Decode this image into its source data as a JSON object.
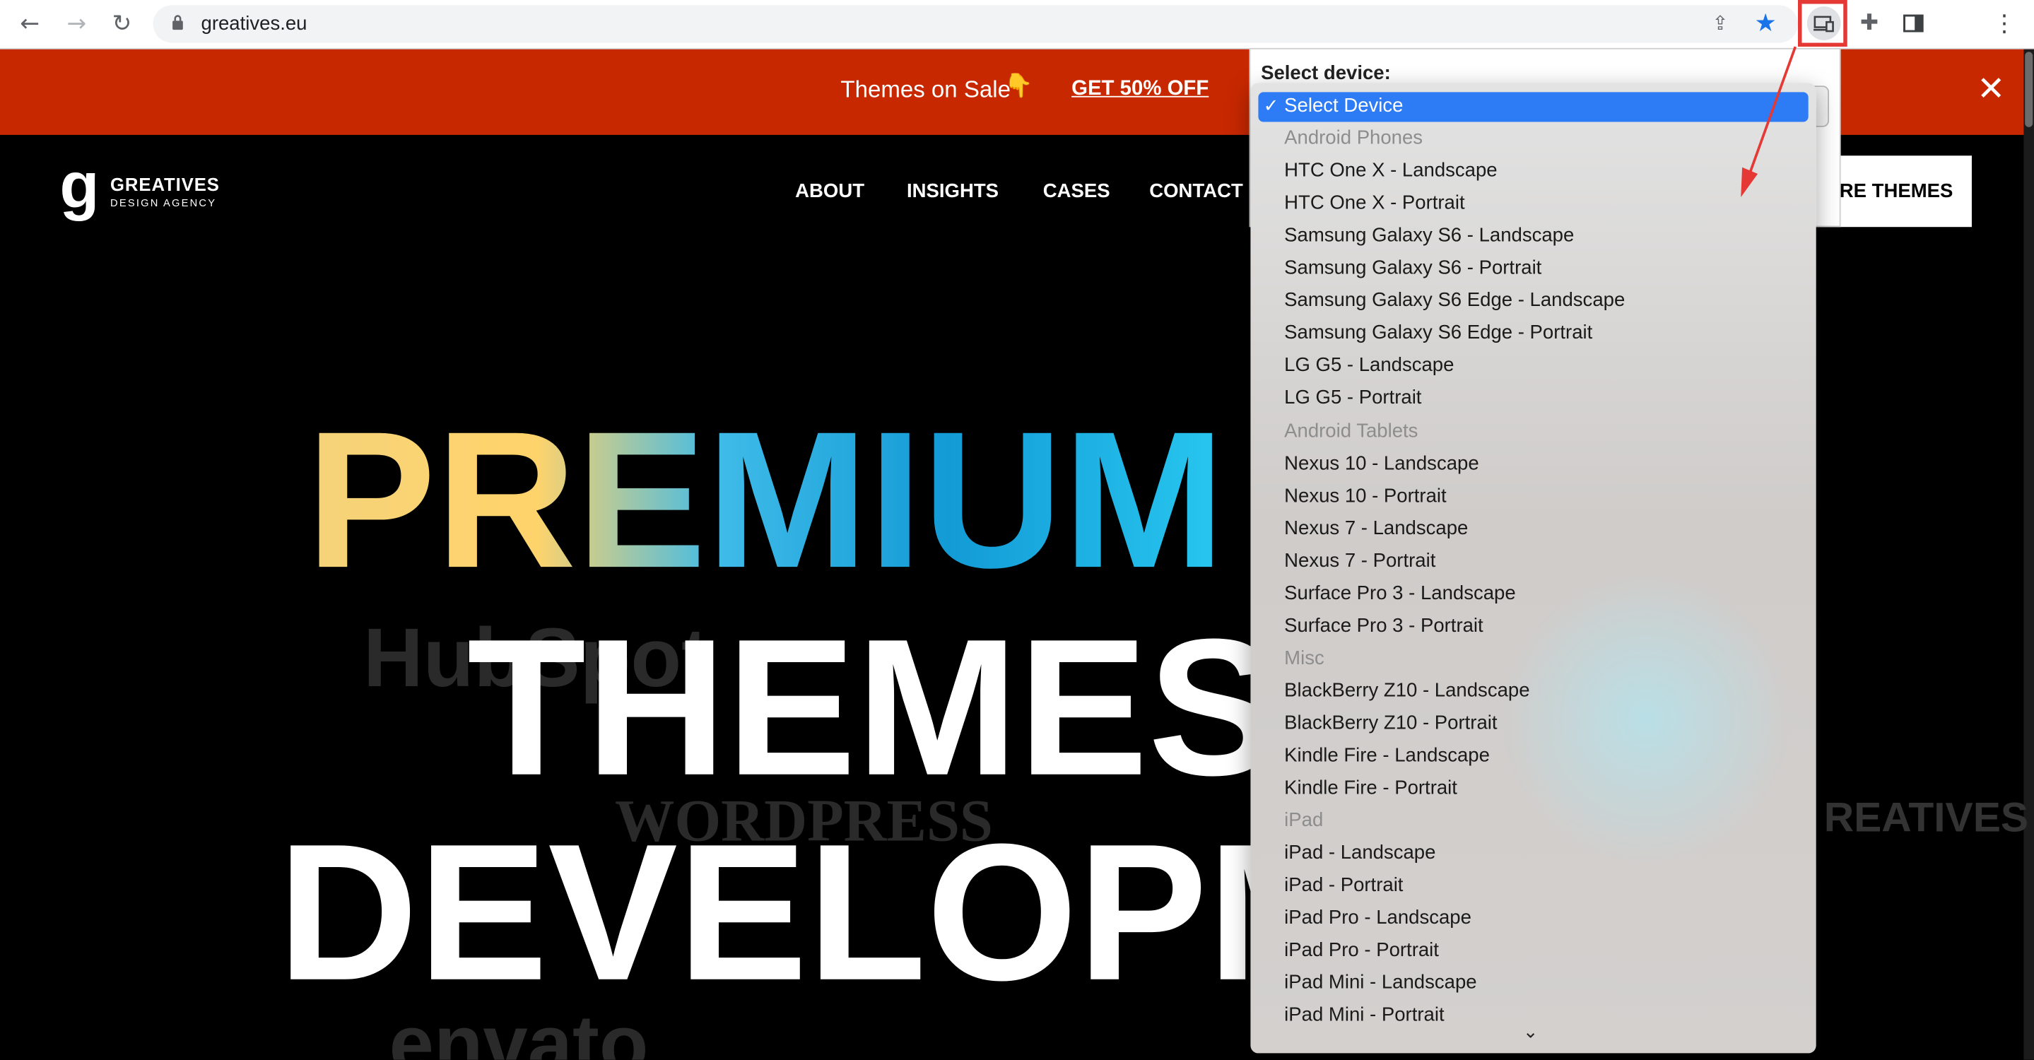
{
  "browser": {
    "url": "greatives.eu",
    "icons": [
      "back-arrow-icon",
      "forward-arrow-icon",
      "reload-icon",
      "lock-icon",
      "share-icon",
      "bookmark-star-icon",
      "device-emulator-icon",
      "puzzle-extension-icon",
      "side-panel-icon",
      "more-menu-icon"
    ],
    "accent": "#1a73e8"
  },
  "promo": {
    "text": "Themes on Sale",
    "emoji": "👇",
    "link": "GET 50% OFF",
    "close": "✕",
    "color": "#c72800"
  },
  "site": {
    "logo_letter": "g",
    "logo_name": "GREATIVES",
    "logo_sub": "DESIGN AGENCY",
    "nav": [
      "ABOUT",
      "INSIGHTS",
      "CASES",
      "CONTACT"
    ],
    "cta": "RE THEMES"
  },
  "hero": {
    "line1": "PREMIUM",
    "line2": "THEMES",
    "line3": "DEVELOPM",
    "ghost_brands": [
      "HubSpot",
      "WORDPRESS",
      "envato",
      "REATIVES"
    ]
  },
  "device_menu": {
    "title": "Select device:",
    "check": "✓",
    "items": [
      {
        "label": "Select Device",
        "type": "selected"
      },
      {
        "label": "Android Phones",
        "type": "group"
      },
      {
        "label": "HTC One X - Landscape",
        "type": "option"
      },
      {
        "label": "HTC One X - Portrait",
        "type": "option"
      },
      {
        "label": "Samsung Galaxy S6 - Landscape",
        "type": "option"
      },
      {
        "label": "Samsung Galaxy S6 - Portrait",
        "type": "option"
      },
      {
        "label": "Samsung Galaxy S6 Edge - Landscape",
        "type": "option"
      },
      {
        "label": "Samsung Galaxy S6 Edge - Portrait",
        "type": "option"
      },
      {
        "label": "LG G5 - Landscape",
        "type": "option"
      },
      {
        "label": "LG G5 - Portrait",
        "type": "option"
      },
      {
        "label": "Android Tablets",
        "type": "group"
      },
      {
        "label": "Nexus 10 - Landscape",
        "type": "option"
      },
      {
        "label": "Nexus 10 - Portrait",
        "type": "option"
      },
      {
        "label": "Nexus 7 - Landscape",
        "type": "option"
      },
      {
        "label": "Nexus 7 - Portrait",
        "type": "option"
      },
      {
        "label": "Surface Pro 3 - Landscape",
        "type": "option"
      },
      {
        "label": "Surface Pro 3 - Portrait",
        "type": "option"
      },
      {
        "label": "Misc",
        "type": "group"
      },
      {
        "label": "BlackBerry Z10 - Landscape",
        "type": "option"
      },
      {
        "label": "BlackBerry Z10 - Portrait",
        "type": "option"
      },
      {
        "label": "Kindle Fire - Landscape",
        "type": "option"
      },
      {
        "label": "Kindle Fire - Portrait",
        "type": "option"
      },
      {
        "label": "iPad",
        "type": "group"
      },
      {
        "label": "iPad - Landscape",
        "type": "option"
      },
      {
        "label": "iPad - Portrait",
        "type": "option"
      },
      {
        "label": "iPad Pro - Landscape",
        "type": "option"
      },
      {
        "label": "iPad Pro - Portrait",
        "type": "option"
      },
      {
        "label": "iPad Mini - Landscape",
        "type": "option"
      },
      {
        "label": "iPad Mini - Portrait",
        "type": "option"
      }
    ],
    "more": "⌄",
    "highlight_color": "#2e7bf6"
  },
  "annotation": {
    "color": "#e53935"
  }
}
